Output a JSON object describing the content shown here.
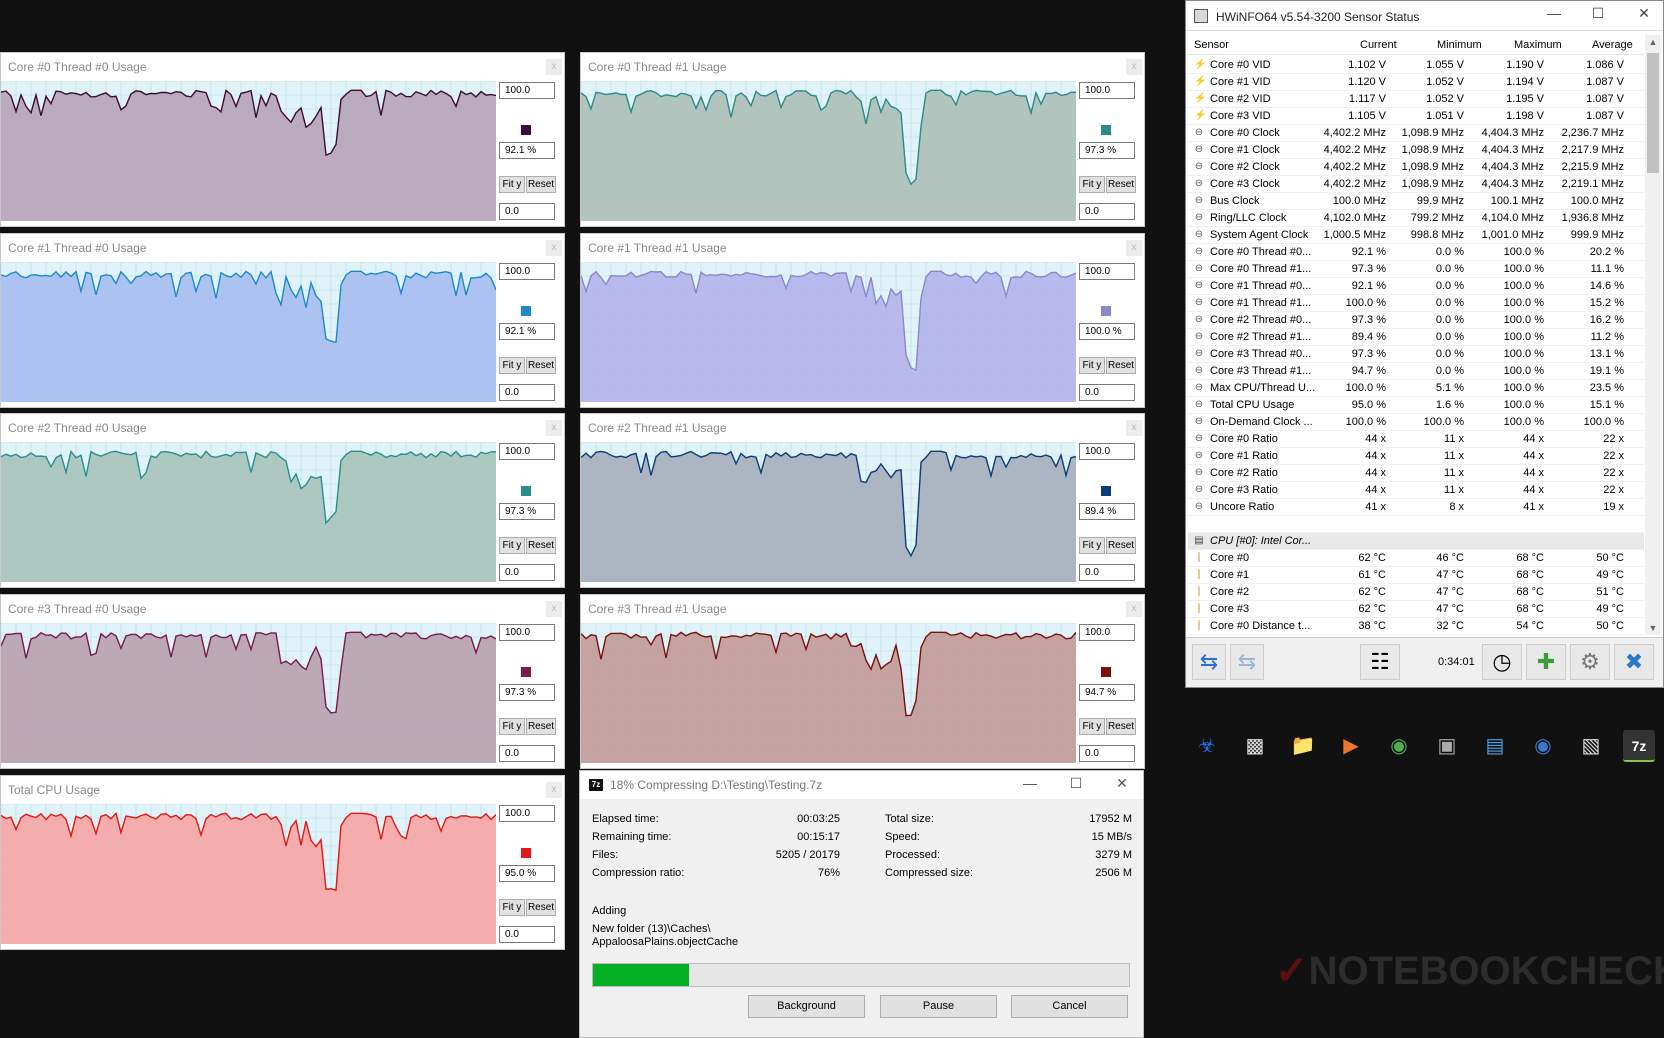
{
  "graphs": [
    {
      "title": "Core #0 Thread #0 Usage",
      "max": "100.0",
      "current": "92.1 %",
      "min": "0.0",
      "color": "#3d0a3a",
      "bg": "#b6a6b6",
      "dip": 0.52
    },
    {
      "title": "Core #0 Thread #1 Usage",
      "max": "100.0",
      "current": "97.3 %",
      "min": "0.0",
      "color": "#2e8a85",
      "bg": "#aec0b8",
      "dip": 0.78
    },
    {
      "title": "Core #1 Thread #0 Usage",
      "max": "100.0",
      "current": "92.1 %",
      "min": "0.0",
      "color": "#1e88c8",
      "bg": "#a7bff0",
      "dip": 0.62
    },
    {
      "title": "Core #1 Thread #1 Usage",
      "max": "100.0",
      "current": "100.0 %",
      "min": "0.0",
      "color": "#8a88c8",
      "bg": "#b4b4ec",
      "dip": 0.78
    },
    {
      "title": "Core #2 Thread #0 Usage",
      "max": "100.0",
      "current": "97.3 %",
      "min": "0.0",
      "color": "#2a8f8a",
      "bg": "#a8c4bc",
      "dip": 0.58
    },
    {
      "title": "Core #2 Thread #1 Usage",
      "max": "100.0",
      "current": "89.4 %",
      "min": "0.0",
      "color": "#0e3b7a",
      "bg": "#a7b1be",
      "dip": 0.82
    },
    {
      "title": "Core #3 Thread #0 Usage",
      "max": "100.0",
      "current": "97.3 %",
      "min": "0.0",
      "color": "#7a1a4a",
      "bg": "#b9a3ae",
      "dip": 0.68
    },
    {
      "title": "Core #3 Thread #1 Usage",
      "max": "100.0",
      "current": "94.7 %",
      "min": "0.0",
      "color": "#7a1010",
      "bg": "#c29c98",
      "dip": 0.65
    },
    {
      "title": "Total CPU Usage",
      "max": "100.0",
      "current": "95.0 %",
      "min": "0.0",
      "color": "#e01818",
      "bg": "#f6a6a6",
      "dip": 0.7
    }
  ],
  "graph_buttons": {
    "fit": "Fit y",
    "reset": "Reset",
    "close": "x"
  },
  "hwinfo": {
    "title": "HWiNFO64 v5.54-3200 Sensor Status",
    "columns": [
      "Sensor",
      "Current",
      "Minimum",
      "Maximum",
      "Average"
    ],
    "rows": [
      {
        "icon": "voltage-icon",
        "name": "Core #0 VID",
        "cur": "1.102 V",
        "min": "1.055 V",
        "max": "1.190 V",
        "avg": "1.086 V"
      },
      {
        "icon": "voltage-icon",
        "name": "Core #1 VID",
        "cur": "1.120 V",
        "min": "1.052 V",
        "max": "1.194 V",
        "avg": "1.087 V"
      },
      {
        "icon": "voltage-icon",
        "name": "Core #2 VID",
        "cur": "1.117 V",
        "min": "1.052 V",
        "max": "1.195 V",
        "avg": "1.087 V"
      },
      {
        "icon": "voltage-icon",
        "name": "Core #3 VID",
        "cur": "1.105 V",
        "min": "1.051 V",
        "max": "1.198 V",
        "avg": "1.087 V"
      },
      {
        "icon": "clock-icon",
        "name": "Core #0 Clock",
        "cur": "4,402.2 MHz",
        "min": "1,098.9 MHz",
        "max": "4,404.3 MHz",
        "avg": "2,236.7 MHz"
      },
      {
        "icon": "clock-icon",
        "name": "Core #1 Clock",
        "cur": "4,402.2 MHz",
        "min": "1,098.9 MHz",
        "max": "4,404.3 MHz",
        "avg": "2,217.9 MHz"
      },
      {
        "icon": "clock-icon",
        "name": "Core #2 Clock",
        "cur": "4,402.2 MHz",
        "min": "1,098.9 MHz",
        "max": "4,404.3 MHz",
        "avg": "2,215.9 MHz"
      },
      {
        "icon": "clock-icon",
        "name": "Core #3 Clock",
        "cur": "4,402.2 MHz",
        "min": "1,098.9 MHz",
        "max": "4,404.3 MHz",
        "avg": "2,219.1 MHz"
      },
      {
        "icon": "clock-icon",
        "name": "Bus Clock",
        "cur": "100.0 MHz",
        "min": "99.9 MHz",
        "max": "100.1 MHz",
        "avg": "100.0 MHz"
      },
      {
        "icon": "clock-icon",
        "name": "Ring/LLC Clock",
        "cur": "4,102.0 MHz",
        "min": "799.2 MHz",
        "max": "4,104.0 MHz",
        "avg": "1,936.8 MHz"
      },
      {
        "icon": "clock-icon",
        "name": "System Agent Clock",
        "cur": "1,000.5 MHz",
        "min": "998.8 MHz",
        "max": "1,001.0 MHz",
        "avg": "999.9 MHz"
      },
      {
        "icon": "clock-icon",
        "name": "Core #0 Thread #0...",
        "cur": "92.1 %",
        "min": "0.0 %",
        "max": "100.0 %",
        "avg": "20.2 %"
      },
      {
        "icon": "clock-icon",
        "name": "Core #0 Thread #1...",
        "cur": "97.3 %",
        "min": "0.0 %",
        "max": "100.0 %",
        "avg": "11.1 %"
      },
      {
        "icon": "clock-icon",
        "name": "Core #1 Thread #0...",
        "cur": "92.1 %",
        "min": "0.0 %",
        "max": "100.0 %",
        "avg": "14.6 %"
      },
      {
        "icon": "clock-icon",
        "name": "Core #1 Thread #1...",
        "cur": "100.0 %",
        "min": "0.0 %",
        "max": "100.0 %",
        "avg": "15.2 %"
      },
      {
        "icon": "clock-icon",
        "name": "Core #2 Thread #0...",
        "cur": "97.3 %",
        "min": "0.0 %",
        "max": "100.0 %",
        "avg": "16.2 %"
      },
      {
        "icon": "clock-icon",
        "name": "Core #2 Thread #1...",
        "cur": "89.4 %",
        "min": "0.0 %",
        "max": "100.0 %",
        "avg": "11.2 %"
      },
      {
        "icon": "clock-icon",
        "name": "Core #3 Thread #0...",
        "cur": "97.3 %",
        "min": "0.0 %",
        "max": "100.0 %",
        "avg": "13.1 %"
      },
      {
        "icon": "clock-icon",
        "name": "Core #3 Thread #1...",
        "cur": "94.7 %",
        "min": "0.0 %",
        "max": "100.0 %",
        "avg": "19.1 %"
      },
      {
        "icon": "clock-icon",
        "name": "Max CPU/Thread U...",
        "cur": "100.0 %",
        "min": "5.1 %",
        "max": "100.0 %",
        "avg": "23.5 %"
      },
      {
        "icon": "clock-icon",
        "name": "Total CPU Usage",
        "cur": "95.0 %",
        "min": "1.6 %",
        "max": "100.0 %",
        "avg": "15.1 %"
      },
      {
        "icon": "clock-icon",
        "name": "On-Demand Clock ...",
        "cur": "100.0 %",
        "min": "100.0 %",
        "max": "100.0 %",
        "avg": "100.0 %"
      },
      {
        "icon": "clock-icon",
        "name": "Core #0 Ratio",
        "cur": "44 x",
        "min": "11 x",
        "max": "44 x",
        "avg": "22 x"
      },
      {
        "icon": "clock-icon",
        "name": "Core #1 Ratio",
        "cur": "44 x",
        "min": "11 x",
        "max": "44 x",
        "avg": "22 x"
      },
      {
        "icon": "clock-icon",
        "name": "Core #2 Ratio",
        "cur": "44 x",
        "min": "11 x",
        "max": "44 x",
        "avg": "22 x"
      },
      {
        "icon": "clock-icon",
        "name": "Core #3 Ratio",
        "cur": "44 x",
        "min": "11 x",
        "max": "44 x",
        "avg": "22 x"
      },
      {
        "icon": "clock-icon",
        "name": "Uncore Ratio",
        "cur": "41 x",
        "min": "8 x",
        "max": "41 x",
        "avg": "19 x"
      },
      {
        "icon": "blank",
        "name": "",
        "cur": "",
        "min": "",
        "max": "",
        "avg": ""
      },
      {
        "icon": "chip-icon",
        "name": "CPU [#0]: Intel Cor...",
        "cur": "",
        "min": "",
        "max": "",
        "avg": "",
        "group": true
      },
      {
        "icon": "thermometer-icon",
        "name": "Core #0",
        "cur": "62 °C",
        "min": "46 °C",
        "max": "68 °C",
        "avg": "50 °C"
      },
      {
        "icon": "thermometer-icon",
        "name": "Core #1",
        "cur": "61 °C",
        "min": "47 °C",
        "max": "68 °C",
        "avg": "49 °C"
      },
      {
        "icon": "thermometer-icon",
        "name": "Core #2",
        "cur": "62 °C",
        "min": "47 °C",
        "max": "68 °C",
        "avg": "51 °C"
      },
      {
        "icon": "thermometer-icon",
        "name": "Core #3",
        "cur": "62 °C",
        "min": "47 °C",
        "max": "68 °C",
        "avg": "49 °C"
      },
      {
        "icon": "thermometer-icon",
        "name": "Core #0 Distance t...",
        "cur": "38 °C",
        "min": "32 °C",
        "max": "54 °C",
        "avg": "50 °C"
      }
    ],
    "elapsed": "0:34:01"
  },
  "taskbar": [
    "biohazard-icon",
    "task-view-icon",
    "file-explorer-icon",
    "media-player-icon",
    "chrome-icon",
    "photo-viewer-icon",
    "remote-desktop-icon",
    "steam-icon",
    "hwinfo-icon",
    "7zip-icon"
  ],
  "zip": {
    "title": "18% Compressing D:\\Testing\\Testing.7z",
    "left": [
      {
        "k": "Elapsed time:",
        "v": "00:03:25"
      },
      {
        "k": "Remaining time:",
        "v": "00:15:17"
      },
      {
        "k": "Files:",
        "v": "5205 / 20179"
      },
      {
        "k": "Compression ratio:",
        "v": "76%"
      }
    ],
    "right": [
      {
        "k": "Total size:",
        "v": "17952 M"
      },
      {
        "k": "Speed:",
        "v": "15 MB/s"
      },
      {
        "k": "Processed:",
        "v": "3279 M"
      },
      {
        "k": "Compressed size:",
        "v": "2506 M"
      }
    ],
    "status": "Adding",
    "path1": "New folder (13)\\Caches\\",
    "path2": "AppaloosaPlains.objectCache",
    "progress": 0.18,
    "buttons": [
      "Background",
      "Pause",
      "Cancel"
    ]
  },
  "watermark": "NOTEBOOKCHECK"
}
